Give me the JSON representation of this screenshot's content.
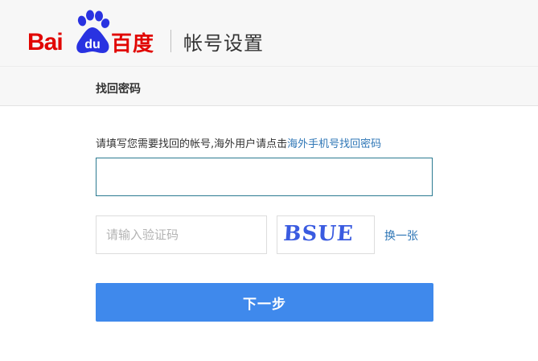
{
  "brand": {
    "bai": "Bai",
    "du": "du",
    "cn": "百度",
    "color": "#e10602",
    "paw_color": "#2932e1"
  },
  "header": {
    "page_title": "帐号设置"
  },
  "subbar": {
    "title": "找回密码"
  },
  "form": {
    "instruction": "请填写您需要找回的帐号,海外用户请点击",
    "overseas_link": "海外手机号找回密码",
    "account_value": "",
    "captcha_placeholder": "请输入验证码",
    "captcha_text": "BSUE",
    "captcha_color": "#3a5be0",
    "refresh_label": "换一张",
    "next_label": "下一步"
  },
  "colors": {
    "link": "#2e76b6",
    "button": "#3f89ec",
    "header_bg": "#f7f7f7"
  }
}
